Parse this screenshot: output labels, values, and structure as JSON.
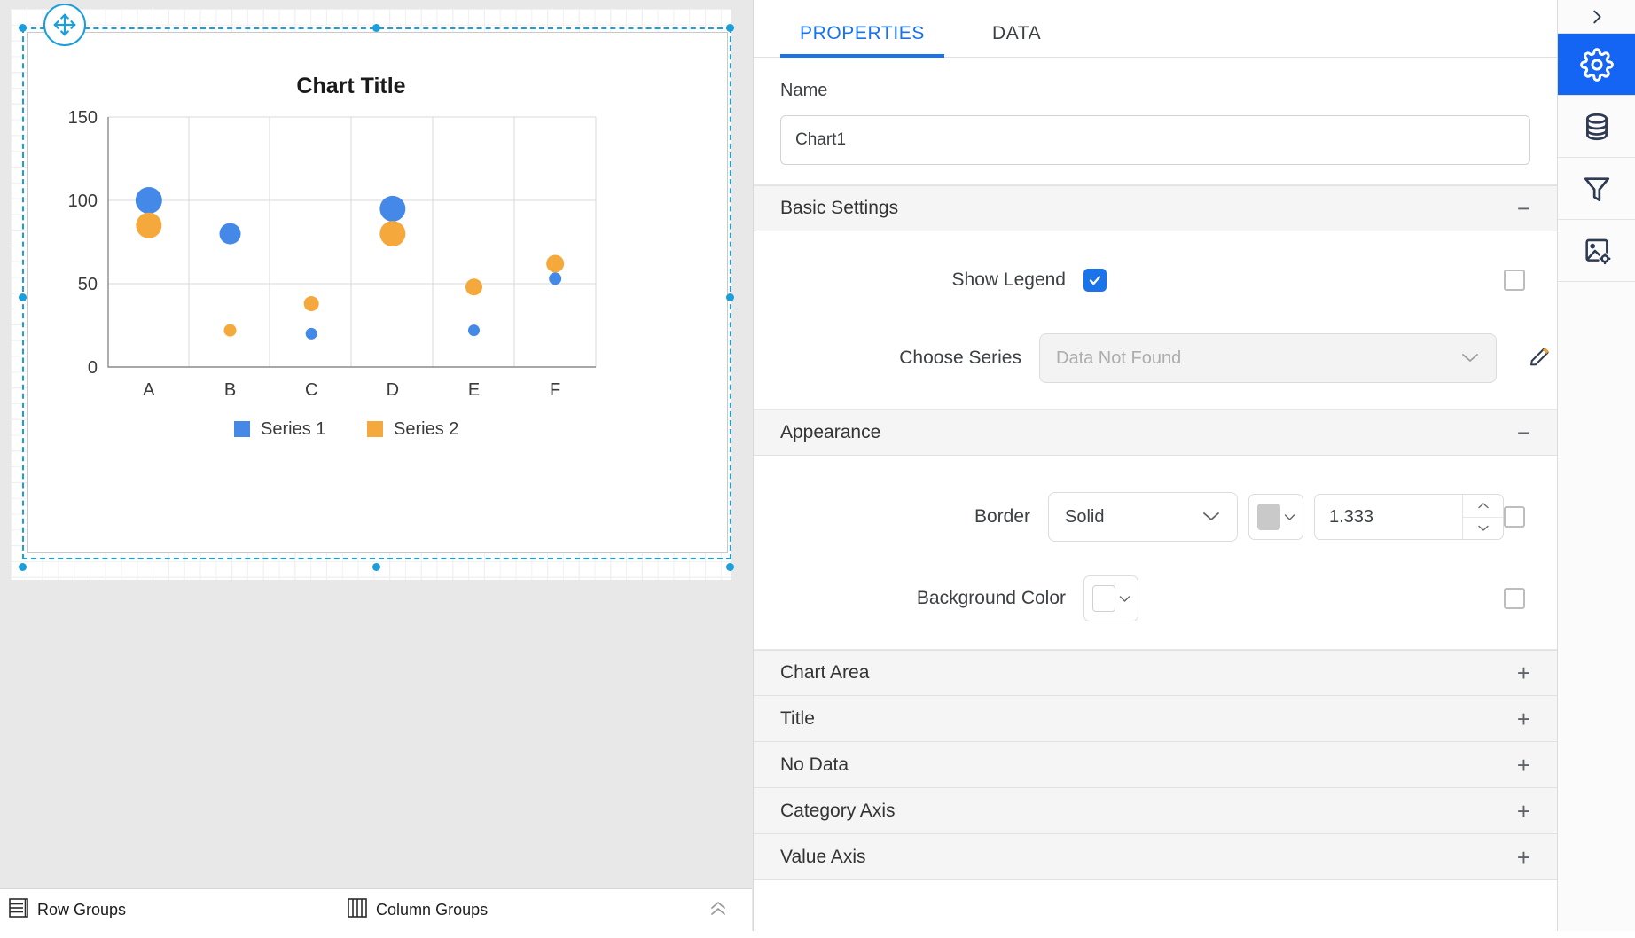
{
  "designer": {
    "move_handle_icon": "move-icon",
    "group_bar": {
      "row_groups_label": "Row Groups",
      "row_groups_icon": "row-groups-icon",
      "column_groups_label": "Column Groups",
      "column_groups_icon": "column-groups-icon",
      "collapse_icon": "chevron-double-up-icon",
      "collapse_glyph": "⌃"
    }
  },
  "chart_data": {
    "type": "scatter",
    "chart_variant": "bubble",
    "title": "Chart Title",
    "xlabel": "",
    "ylabel": "",
    "categories": [
      "A",
      "B",
      "C",
      "D",
      "E",
      "F"
    ],
    "ytick_labels": [
      "0",
      "50",
      "100",
      "150"
    ],
    "yticks": [
      0,
      50,
      100,
      150
    ],
    "ylim": [
      0,
      150
    ],
    "grid": true,
    "legend": true,
    "legend_position": "bottom",
    "series": [
      {
        "name": "Series 1",
        "color": "#4589e8",
        "values": [
          100,
          80,
          20,
          95,
          22,
          53
        ],
        "sizes": [
          30,
          24,
          13,
          29,
          13,
          14
        ]
      },
      {
        "name": "Series 2",
        "color": "#f5a93c",
        "values": [
          85,
          22,
          38,
          80,
          48,
          62
        ],
        "sizes": [
          29,
          14,
          17,
          29,
          19,
          20
        ]
      }
    ]
  },
  "properties_panel": {
    "tabs": [
      {
        "label": "PROPERTIES",
        "active": true
      },
      {
        "label": "DATA",
        "active": false
      }
    ],
    "name": {
      "label": "Name",
      "value": "Chart1",
      "placeholder": "Name"
    },
    "basic_settings": {
      "title": "Basic Settings",
      "toggle_glyph": "−",
      "show_legend": {
        "label": "Show Legend",
        "checked": true,
        "check_glyph": "✔",
        "expression_checkbox_checked": false
      },
      "choose_series": {
        "label": "Choose Series",
        "value": "",
        "placeholder": "Data Not Found",
        "chevron_glyph": "⌄",
        "edit_icon": "pencil-icon"
      }
    },
    "appearance": {
      "title": "Appearance",
      "toggle_glyph": "−",
      "border": {
        "label": "Border",
        "style_value": "Solid",
        "style_chevron_glyph": "⌄",
        "color_swatch": "#c9c9c9",
        "color_chevron_glyph": "⌄",
        "width_value": "1.333",
        "spinner_up_glyph": "▲",
        "spinner_down_glyph": "▼",
        "expression_checkbox_checked": false
      },
      "background_color": {
        "label": "Background Color",
        "color_swatch": "#ffffff",
        "chevron_glyph": "⌄",
        "expression_checkbox_checked": false
      }
    },
    "collapsed_sections": [
      {
        "title": "Chart Area",
        "toggle_glyph": "+"
      },
      {
        "title": "Title",
        "toggle_glyph": "+"
      },
      {
        "title": "No Data",
        "toggle_glyph": "+"
      },
      {
        "title": "Category Axis",
        "toggle_glyph": "+"
      },
      {
        "title": "Value Axis",
        "toggle_glyph": "+"
      }
    ]
  },
  "icon_rail": [
    {
      "icon": "chevron-right-icon",
      "active": false,
      "name": "expand-panel"
    },
    {
      "icon": "gear-icon",
      "active": true,
      "name": "properties"
    },
    {
      "icon": "database-icon",
      "active": false,
      "name": "data-sources"
    },
    {
      "icon": "filter-icon",
      "active": false,
      "name": "filters"
    },
    {
      "icon": "image-settings-icon",
      "active": false,
      "name": "report-settings"
    }
  ],
  "colors": {
    "accent": "#1a73e8",
    "selection": "#1a9fdc",
    "series1": "#4589e8",
    "series2": "#f5a93c",
    "rail_active": "#1565f5"
  }
}
